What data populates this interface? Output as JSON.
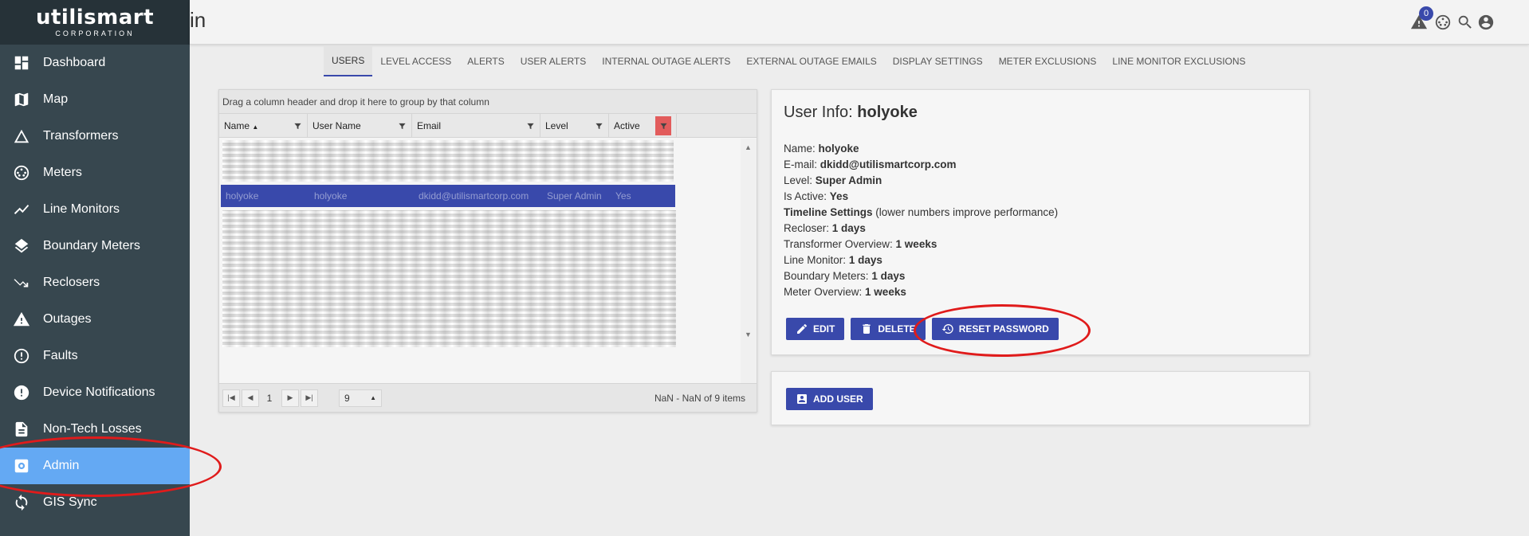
{
  "logo": {
    "brand": "utilismart",
    "sub": "CORPORATION"
  },
  "header": {
    "title_fragment": "in",
    "notification_count": "0"
  },
  "sidebar": {
    "items": [
      {
        "label": "Dashboard",
        "icon": "dashboard-icon"
      },
      {
        "label": "Map",
        "icon": "map-icon"
      },
      {
        "label": "Transformers",
        "icon": "triangle-icon"
      },
      {
        "label": "Meters",
        "icon": "meter-icon"
      },
      {
        "label": "Line Monitors",
        "icon": "line-chart-icon"
      },
      {
        "label": "Boundary Meters",
        "icon": "layers-icon"
      },
      {
        "label": "Reclosers",
        "icon": "recloser-icon"
      },
      {
        "label": "Outages",
        "icon": "warning-icon"
      },
      {
        "label": "Faults",
        "icon": "alert-circle-icon"
      },
      {
        "label": "Device Notifications",
        "icon": "notification-icon"
      },
      {
        "label": "Non-Tech Losses",
        "icon": "document-icon"
      },
      {
        "label": "Admin",
        "icon": "admin-icon",
        "active": true
      },
      {
        "label": "GIS Sync",
        "icon": "sync-icon"
      }
    ]
  },
  "tabs": [
    {
      "label": "USERS",
      "active": true
    },
    {
      "label": "LEVEL ACCESS"
    },
    {
      "label": "ALERTS"
    },
    {
      "label": "USER ALERTS"
    },
    {
      "label": "INTERNAL OUTAGE ALERTS"
    },
    {
      "label": "EXTERNAL OUTAGE EMAILS"
    },
    {
      "label": "DISPLAY SETTINGS"
    },
    {
      "label": "METER EXCLUSIONS"
    },
    {
      "label": "LINE MONITOR EXCLUSIONS"
    }
  ],
  "grid": {
    "group_hint": "Drag a column header and drop it here to group by that column",
    "columns": [
      "Name",
      "User Name",
      "Email",
      "Level",
      "Active"
    ],
    "selected_row": [
      "holyoke",
      "holyoke",
      "dkidd@utilismartcorp.com",
      "Super Admin",
      "Yes"
    ],
    "pager": {
      "page": "1",
      "page_size": "9",
      "info": "NaN - NaN of 9 items"
    }
  },
  "user_info": {
    "title_prefix": "User Info:",
    "username": "holyoke",
    "name_label": "Name:",
    "name": "holyoke",
    "email_label": "E-mail:",
    "email": "dkidd@utilismartcorp.com",
    "level_label": "Level:",
    "level": "Super Admin",
    "active_label": "Is Active:",
    "active": "Yes",
    "timeline_label": "Timeline Settings",
    "timeline_note": "(lower numbers improve performance)",
    "recloser_label": "Recloser:",
    "recloser": "1 days",
    "transformer_label": "Transformer Overview:",
    "transformer": "1 weeks",
    "line_monitor_label": "Line Monitor:",
    "line_monitor": "1 days",
    "boundary_label": "Boundary Meters:",
    "boundary": "1 days",
    "meter_label": "Meter Overview:",
    "meter": "1 weeks"
  },
  "buttons": {
    "edit": "EDIT",
    "delete": "DELETE",
    "reset_password": "RESET PASSWORD",
    "add_user": "ADD USER"
  },
  "colors": {
    "sidebar": "#37474f",
    "accent": "#3949ab",
    "active_nav": "#64a9f3",
    "annotation": "#e01b1b"
  }
}
